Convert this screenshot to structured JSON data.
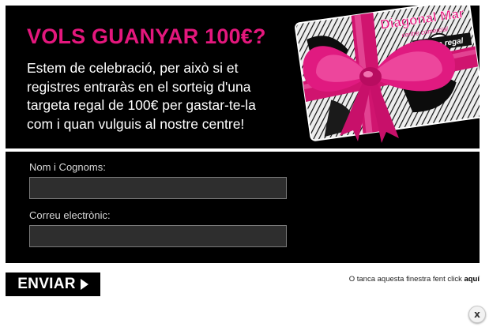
{
  "banner": {
    "title": "VOLS GUANYAR 100€?",
    "text": "Estem de celebració, per això si et registres entraràs en el sorteig d'una targeta regal de 100€ per gastar-te-la com i quan vulguis al nostre centre!",
    "card": {
      "brand": "Diagonal Mar",
      "subtitle": "centre comercial",
      "label": "targeta regal"
    },
    "accent_color": "#e4177d"
  },
  "form": {
    "name_label": "Nom i Cognoms:",
    "name_value": "",
    "email_label": "Correu electrònic:",
    "email_value": ""
  },
  "submit": {
    "label": "ENVIAR",
    "icon": "play-icon"
  },
  "close_hint": {
    "text": "O tanca aquesta finestra fent click",
    "link": "aquí"
  },
  "close_button": {
    "label": "x",
    "icon": "close-icon"
  }
}
